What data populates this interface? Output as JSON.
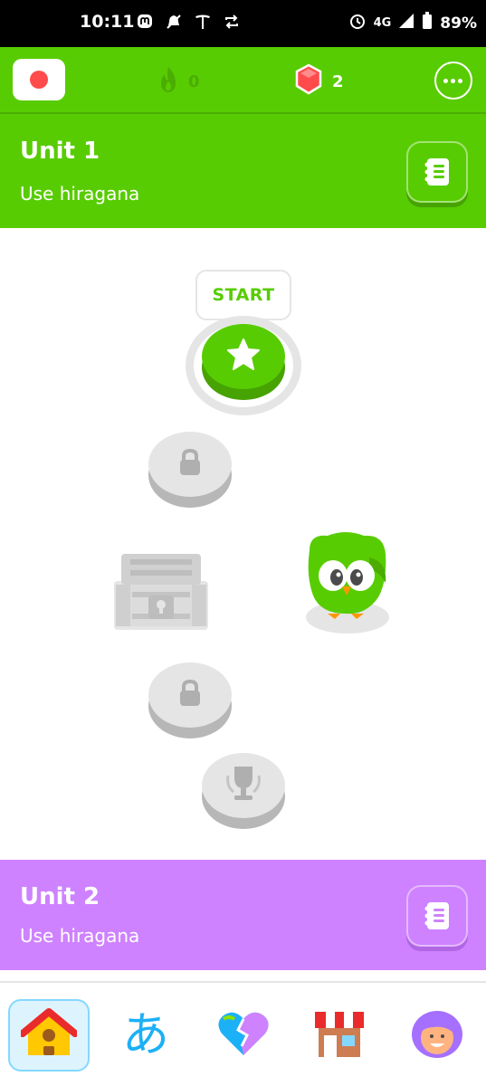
{
  "status_bar": {
    "time": "10:11",
    "network": "4G",
    "battery": "89%"
  },
  "top_bar": {
    "streak_count": "0",
    "gem_count": "2"
  },
  "units": [
    {
      "title": "Unit 1",
      "subtitle": "Use hiragana",
      "color": "#58cc02"
    },
    {
      "title": "Unit 2",
      "subtitle": "Use hiragana",
      "color": "#ce82ff"
    }
  ],
  "path": {
    "start_label": "START",
    "nodes": [
      {
        "kind": "lesson",
        "state": "active",
        "icon": "star-icon"
      },
      {
        "kind": "lesson",
        "state": "locked",
        "icon": "lock-icon"
      },
      {
        "kind": "chest",
        "state": "locked",
        "icon": "treasure-chest-icon"
      },
      {
        "kind": "lesson",
        "state": "locked",
        "icon": "lock-icon"
      },
      {
        "kind": "trophy",
        "state": "locked",
        "icon": "trophy-icon"
      }
    ]
  },
  "bottom_nav": {
    "items": [
      {
        "name": "home",
        "icon": "home-icon",
        "active": true
      },
      {
        "name": "characters",
        "icon": "hiragana-icon",
        "glyph": "あ",
        "active": false
      },
      {
        "name": "practice",
        "icon": "heart-icon",
        "active": false
      },
      {
        "name": "shop",
        "icon": "shop-icon",
        "active": false
      },
      {
        "name": "profile",
        "icon": "avatar-icon",
        "active": false
      }
    ]
  },
  "colors": {
    "green": "#58cc02",
    "purple": "#ce82ff",
    "gray": "#e5e5e5",
    "blue": "#1cb0f6"
  }
}
